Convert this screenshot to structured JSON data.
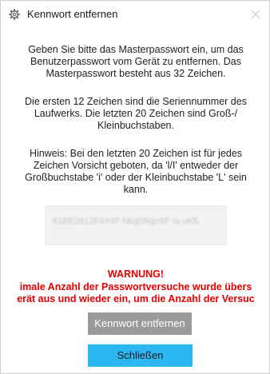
{
  "dialog": {
    "title": "Kennwort entfernen",
    "icon": "gear-icon",
    "close_icon": "close-icon"
  },
  "paragraphs": {
    "p1": [
      "Geben Sie bitte das Masterpasswort ein, um das",
      "Benutzerpasswort vom Gerät zu entfernen. Das",
      "Masterpasswort besteht aus 32 Zeichen."
    ],
    "p2": [
      "Die ersten 12 Zeichen sind die Seriennummer des",
      "Laufwerks. Die letzten 20 Zeichen sind Groß-/",
      "Kleinbuchstaben."
    ],
    "p3": [
      "Hinweis: Bei den letzten 20 Zeichen ist für jedes",
      "Zeichen Vorsicht geboten, da 'l/I' entweder der",
      "Großbuchstabe 'i' oder der Kleinbuchstabe 'L' sein",
      "kann."
    ]
  },
  "password_field": {
    "value": "61BE2812F4Y4F hKghfkgrrl/F ia uKfL"
  },
  "warning": {
    "title": "WARNUNG!",
    "line1": "imale Anzahl der Passwortversuche wurde übers",
    "line2": "erät aus und wieder ein, um die Anzahl der Versuc"
  },
  "buttons": {
    "remove_label": "Kennwort entfernen",
    "close_label": "Schließen"
  },
  "colors": {
    "warning": "#e60000",
    "remove_button": "#9a9a9a",
    "close_button": "#2cb7f3"
  }
}
